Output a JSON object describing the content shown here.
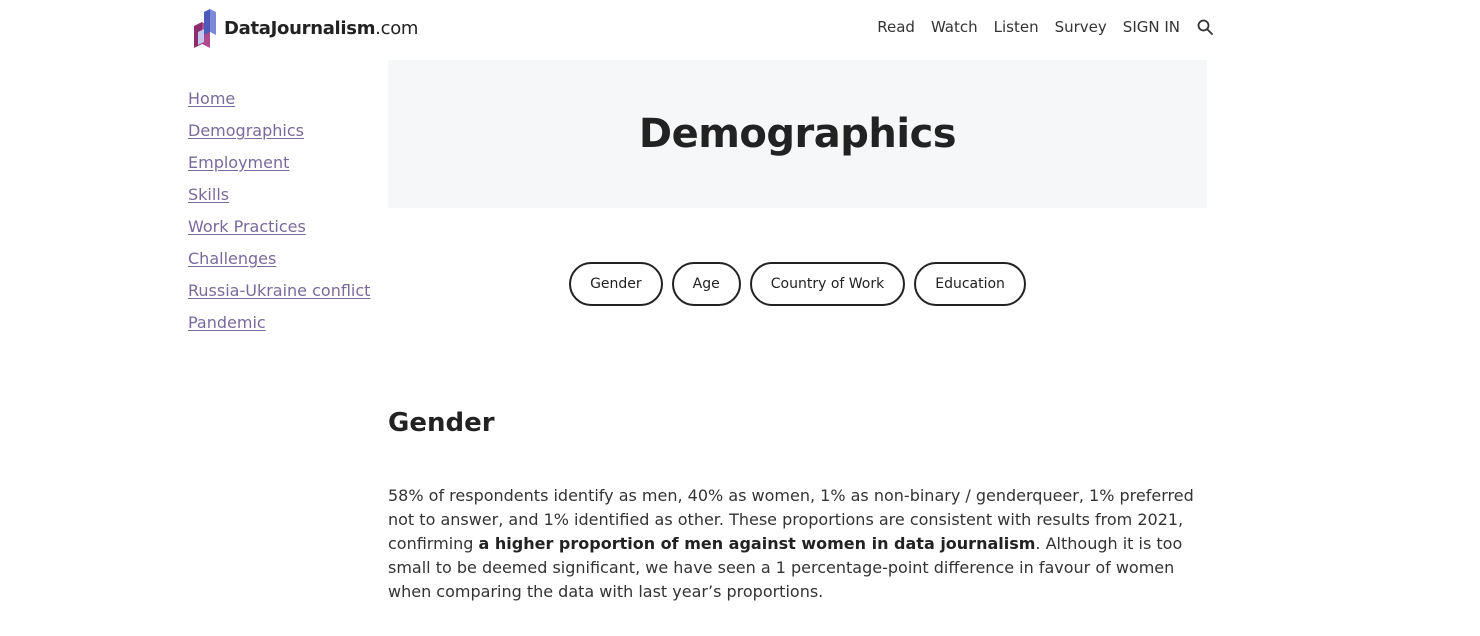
{
  "header": {
    "logo": {
      "brand_bold": "DataJournalism",
      "brand_suffix": ".com"
    },
    "nav": [
      "Read",
      "Watch",
      "Listen",
      "Survey",
      "SIGN IN"
    ],
    "search_icon": "search-icon"
  },
  "sidebar": {
    "items": [
      {
        "label": "Home"
      },
      {
        "label": "Demographics"
      },
      {
        "label": "Employment"
      },
      {
        "label": "Skills"
      },
      {
        "label": "Work Practices"
      },
      {
        "label": "Challenges"
      },
      {
        "label": "Russia-Ukraine conflict"
      },
      {
        "label": "Pandemic"
      }
    ],
    "link_color": "#7a6a9c"
  },
  "hero": {
    "title": "Demographics",
    "background": "#f6f7f8"
  },
  "filters": [
    "Gender",
    "Age",
    "Country of Work",
    "Education"
  ],
  "section": {
    "title": "Gender",
    "paragraph": {
      "part1": "58% of respondents identify as men, 40% as women, 1% as non-binary / genderqueer, 1% preferred not to answer, and 1% identified as other. These proportions are consistent with results from 2021, confirming ",
      "bold": "a higher proportion of men against women in data journalism",
      "part2": ". Although it is too small to be deemed significant, we have seen a 1 percentage-point difference in favour of women when comparing the data with last year’s proportions."
    }
  }
}
